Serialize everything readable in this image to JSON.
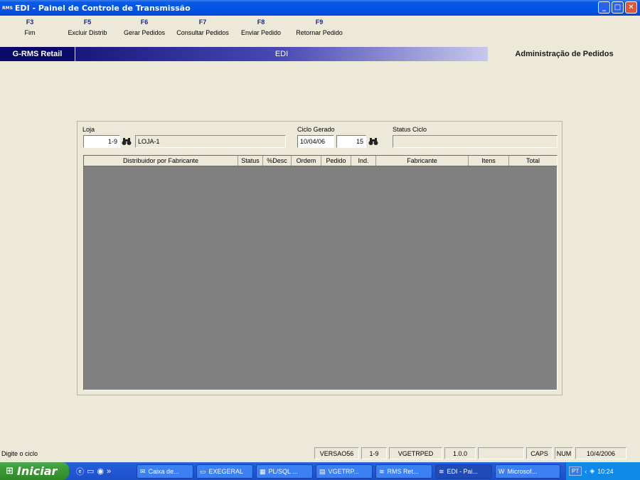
{
  "window": {
    "logo": "RMS",
    "title": "EDI - Painel de Controle de Transmissão",
    "minimize": "_",
    "restore": "□",
    "close": "✕"
  },
  "fkeys": [
    {
      "key": "F3",
      "label": "Fim"
    },
    {
      "key": "F5",
      "label": "Excluir Distrib"
    },
    {
      "key": "F6",
      "label": "Gerar Pedidos"
    },
    {
      "key": "F7",
      "label": "Consultar Pedidos"
    },
    {
      "key": "F8",
      "label": "Enviar Pedido"
    },
    {
      "key": "F9",
      "label": "Retornar Pedido"
    }
  ],
  "band": {
    "left": "G-RMS Retail",
    "mid": "EDI",
    "right": "Administração de Pedidos"
  },
  "form": {
    "loja_label": "Loja",
    "loja_code": "1-9",
    "loja_name": "LOJA-1",
    "ciclo_label": "Ciclo Gerado",
    "ciclo_date": "10/04/06",
    "ciclo_num": "15",
    "status_label": "Status Ciclo",
    "status_value": ""
  },
  "grid": {
    "columns": [
      "Distribuidor por Fabricante",
      "Status",
      "%Desc",
      "Ordem",
      "Pedido",
      "Ind.",
      "Fabricante",
      "Itens",
      "Total"
    ]
  },
  "statusbar": {
    "message": "Digite o ciclo",
    "version": "VERSAO56",
    "loja": "1-9",
    "program": "VGETRPED",
    "prog_version": "1.0.0",
    "caps": "CAPS",
    "num": "NUM",
    "date": "10/4/2006"
  },
  "taskbar": {
    "start": "Iniciar",
    "buttons": [
      {
        "label": "Caixa de..."
      },
      {
        "label": "EXEGERAL"
      },
      {
        "label": "PL/SQL ..."
      },
      {
        "label": "VGETRP..."
      },
      {
        "label": "RMS Ret..."
      },
      {
        "label": "EDI - Pai..."
      },
      {
        "label": "Microsof..."
      }
    ],
    "lang": "PT",
    "clock": "10:24"
  }
}
